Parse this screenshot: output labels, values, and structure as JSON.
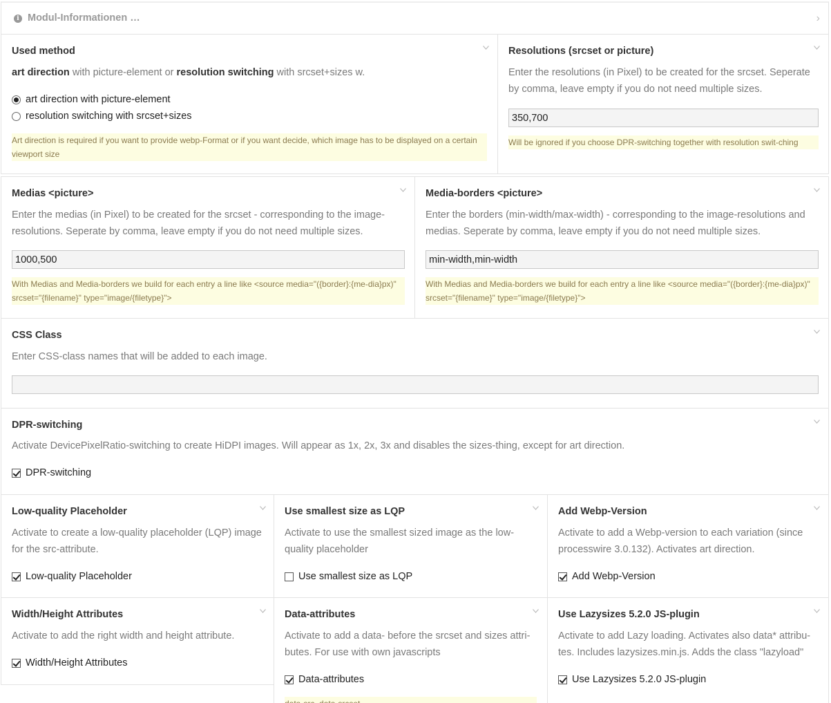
{
  "header": {
    "title": "Modul-Informationen …"
  },
  "used_method": {
    "label": "Used method",
    "desc_b1": "art direction",
    "desc_t1": " with picture-element or ",
    "desc_b2": "resolution switching",
    "desc_t2": " with srcset+sizes w.",
    "options": [
      {
        "label": "art direction with picture-element",
        "checked": true
      },
      {
        "label": "resolution switching with srcset+sizes",
        "checked": false
      }
    ],
    "note": "Art direction is required if you want to provide webp-Format or if you want decide, which image has to be displayed on a certain viewport size"
  },
  "resolutions": {
    "label": "Resolutions (srcset or picture)",
    "desc": "Enter the resolutions (in Pixel) to be created for the srcset. Seperate by comma, leave empty if you do not need multiple sizes.",
    "value": "350,700",
    "note": "Will be ignored if you choose DPR-switching together with resolution swit-ching"
  },
  "medias": {
    "label": "Medias <picture>",
    "desc": "Enter the medias (in Pixel) to be created for the srcset - corresponding to the image-resolutions. Seperate by comma, leave empty if you do not need multiple sizes.",
    "value": "1000,500",
    "note": "With Medias and Media-borders we build for each entry a line like <source media=\"({border}:{me-dia}px)\" srcset=\"{filename}\" type=\"image/{filetype}\">"
  },
  "media_borders": {
    "label": "Media-borders <picture>",
    "desc": "Enter the borders (min-width/max-width) - corresponding to the image-resolutions and medias. Seperate by comma, leave empty if you do not need multiple sizes.",
    "value": "min-width,min-width",
    "note": "With Medias and Media-borders we build for each entry a line like <source media=\"({border}:{me-dia}px)\" srcset=\"{filename}\" type=\"image/{filetype}\">"
  },
  "css_class": {
    "label": "CSS Class",
    "desc": "Enter CSS-class names that will be added to each image.",
    "value": ""
  },
  "dpr": {
    "label": "DPR-switching",
    "desc": "Activate DevicePixelRatio-switching to create HiDPI images. Will appear as 1x, 2x, 3x and disables the sizes-thing, except for art direction.",
    "checkbox": "DPR-switching",
    "checked": true
  },
  "lqp": {
    "label": "Low-quality Placeholder",
    "desc": "Activate to create a low-quality placeholder (LQP) image for the src-attribute.",
    "checkbox": "Low-quality Placeholder",
    "checked": true
  },
  "smallest": {
    "label": "Use smallest size as LQP",
    "desc": "Activate to use the smallest sized image as the low-quality placeholder",
    "checkbox": "Use smallest size as LQP",
    "checked": false
  },
  "webp": {
    "label": "Add Webp-Version",
    "desc": "Activate to add a Webp-version to each variation (since processwire 3.0.132). Activates art direction.",
    "checkbox": "Add Webp-Version",
    "checked": true
  },
  "wh": {
    "label": "Width/Height Attributes",
    "desc": "Activate to add the right width and height attribute.",
    "checkbox": "Width/Height Attributes",
    "checked": true
  },
  "data_attr": {
    "label": "Data-attributes",
    "desc": "Activate to add a data- before the srcset and sizes attri-butes. For use with own javascripts",
    "checkbox": "Data-attributes",
    "checked": true,
    "note": "data-src, data-srcset"
  },
  "lazy": {
    "label": "Use Lazysizes 5.2.0 JS-plugin",
    "desc": "Activate to add Lazy loading. Activates also data* attribu-tes. Includes lazysizes.min.js. Adds the class \"lazyload\"",
    "checkbox": "Use Lazysizes 5.2.0 JS-plugin",
    "checked": true
  }
}
